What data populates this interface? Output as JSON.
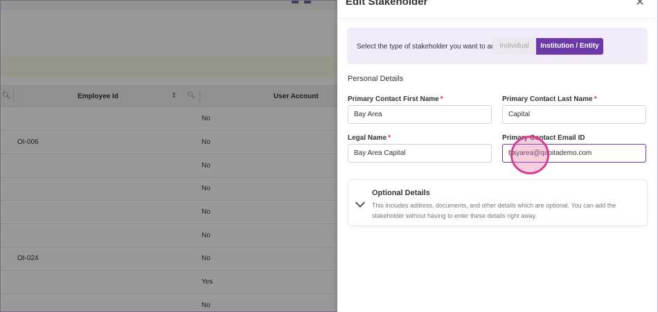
{
  "background": {
    "table": {
      "headers": [
        "Employee Id",
        "User Account"
      ],
      "rows": [
        {
          "employee_id": "",
          "user_account": "No"
        },
        {
          "employee_id": "OI-006",
          "user_account": "No"
        },
        {
          "employee_id": "",
          "user_account": "No"
        },
        {
          "employee_id": "",
          "user_account": "No"
        },
        {
          "employee_id": "",
          "user_account": "No"
        },
        {
          "employee_id": "",
          "user_account": "No"
        },
        {
          "employee_id": "OI-024",
          "user_account": "No"
        },
        {
          "employee_id": "",
          "user_account": "Yes"
        },
        {
          "employee_id": "",
          "user_account": "No"
        }
      ]
    }
  },
  "drawer": {
    "title": "Edit Stakeholder",
    "close_icon": "close-icon",
    "type_selector": {
      "label": "Select the type of stakeholder you want to add",
      "options": [
        "Individual",
        "Institution / Entity"
      ],
      "selected": "Institution / Entity"
    },
    "section_title": "Personal Details",
    "fields": {
      "first_name": {
        "label": "Primary Contact First Name",
        "value": "Bay Area",
        "required": "*"
      },
      "last_name": {
        "label": "Primary Contact Last Name",
        "value": "Capital",
        "required": "*"
      },
      "legal_name": {
        "label": "Legal Name",
        "value": "Bay Area Capital",
        "required": "*"
      },
      "email": {
        "label": "Primary Contact Email ID",
        "value": "bayarea@qapitademo.com"
      }
    },
    "optional": {
      "title": "Optional Details",
      "description": "This includes address, documents, and other details which are optional. You can add the stakeholder without having to enter these details right away."
    }
  },
  "colors": {
    "accent": "#6b3aa8",
    "type_box_bg": "#f1ebfa",
    "required": "#e0245e",
    "click_indicator": "#d43f8d"
  }
}
